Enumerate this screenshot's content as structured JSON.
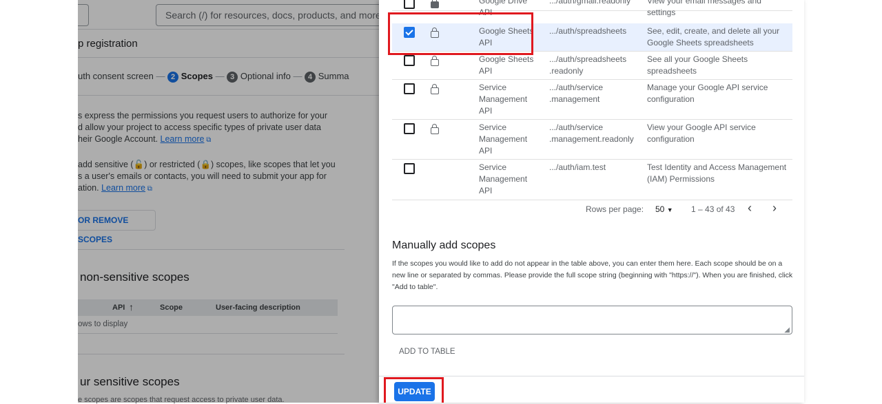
{
  "background": {
    "search_placeholder": "Search (/) for resources, docs, products, and more",
    "page_title": "p registration",
    "stepper": {
      "step1_label": "uth consent screen",
      "step2_num": "2",
      "step2_label": "Scopes",
      "step3_num": "3",
      "step3_label": "Optional info",
      "step4_num": "4",
      "step4_label": "Summa"
    },
    "para1": [
      "s express the permissions you request users to authorize for your",
      "d allow your project to access specific types of private user data",
      "heir Google Account."
    ],
    "learn_more": "Learn more",
    "para2": [
      "add sensitive (",
      ") or restricted (",
      ") scopes, like scopes that let you",
      "s a user's emails or contacts, you will need to submit your app for",
      "ation."
    ],
    "add_remove_button": "OR REMOVE SCOPES",
    "nonsensitive_title": "non-sensitive scopes",
    "table_headers": {
      "api": "API",
      "scope": "Scope",
      "desc": "User-facing description"
    },
    "no_rows": "ows to display",
    "sensitive_title": "ur sensitive scopes",
    "sensitive_desc": "e scopes are scopes that request access to private user data."
  },
  "panel": {
    "rows": [
      {
        "checked": false,
        "lock": true,
        "api": "Google Drive API",
        "scope": ".../auth/gmail.readonly",
        "desc": "View your email messages and settings"
      },
      {
        "checked": true,
        "lock": true,
        "api": "Google Sheets API",
        "scope": ".../auth/spreadsheets",
        "desc": "See, edit, create, and delete all your Google Sheets spreadsheets"
      },
      {
        "checked": false,
        "lock": true,
        "api": "Google Sheets API",
        "scope": ".../auth/spreadsheets .readonly",
        "desc": "See all your Google Sheets spreadsheets"
      },
      {
        "checked": false,
        "lock": true,
        "api": "Service Management API",
        "scope": ".../auth/service .management",
        "desc": "Manage your Google API service configuration"
      },
      {
        "checked": false,
        "lock": true,
        "api": "Service Management API",
        "scope": ".../auth/service .management.readonly",
        "desc": "View your Google API service configuration"
      },
      {
        "checked": false,
        "lock": false,
        "api": "Service Management API",
        "scope": ".../auth/iam.test",
        "desc": "Test Identity and Access Management (IAM) Permissions"
      }
    ],
    "pagination": {
      "rows_per_page_label": "Rows per page:",
      "rows_per_page_value": "50",
      "range": "1 – 43 of 43"
    },
    "manual_title": "Manually add scopes",
    "manual_desc": "If the scopes you would like to add do not appear in the table above, you can enter them here. Each scope should be on a new line or separated by commas. Please provide the full scope string (beginning with \"https://\"). When you are finished, click \"Add to table\".",
    "add_to_table": "ADD TO TABLE",
    "update": "UPDATE"
  }
}
